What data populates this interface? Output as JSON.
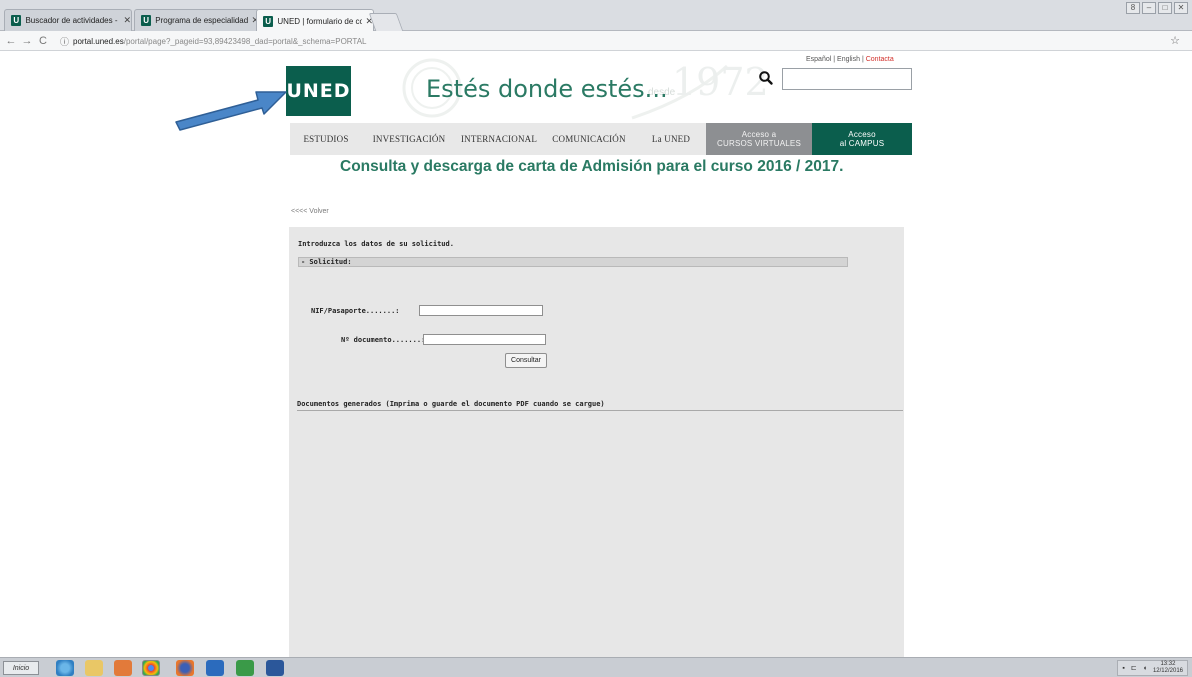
{
  "browser": {
    "tabs": [
      {
        "label": "Buscador de actividades - U",
        "favicon": "U"
      },
      {
        "label": "Programa de especialidad e",
        "favicon": "U"
      },
      {
        "label": "UNED | formulario de consu",
        "favicon": "U",
        "active": true
      }
    ],
    "url_host": "portal.uned.es",
    "url_path": "/portal/page?_pageid=93,89423498_dad=portal&_schema=PORTAL"
  },
  "header": {
    "logo_text": "UNED",
    "slogan": "Estés donde estés...",
    "watermark_desde": "desde",
    "watermark_year": "1972",
    "lang_es": "Español",
    "lang_en": "English",
    "lang_contact": "Contacta",
    "lang_sep": "|"
  },
  "nav": {
    "items": [
      "ESTUDIOS",
      "INVESTIGACIÓN",
      "INTERNACIONAL",
      "COMUNICACIÓN",
      "La UNED"
    ],
    "virtual_line1": "Acceso a",
    "virtual_line2": "CURSOS VIRTUALES",
    "campus_line1": "Acceso",
    "campus_line2": "al CAMPUS"
  },
  "page": {
    "title": "Consulta y descarga de carta de Admisión para el curso 2016 / 2017.",
    "back_link": "<<<< Volver"
  },
  "form": {
    "intro": "Introduzca los datos de su solicitud.",
    "section": "- Solicitud:",
    "nif_label": "NIF/Pasaporte.......:",
    "nif_value": "",
    "doc_label": "Nº documento.......:",
    "doc_value": "",
    "submit_label": "Consultar",
    "docs_title": "Documentos generados (Imprima o guarde el documento PDF cuando se cargue)"
  },
  "taskbar": {
    "start_label": "Inicio",
    "clock_time": "13:32",
    "clock_date": "12/12/2016"
  },
  "colors": {
    "brand_green": "#0b5e4d",
    "title_green": "#2a7a63",
    "arrow_blue": "#4a86c8"
  }
}
